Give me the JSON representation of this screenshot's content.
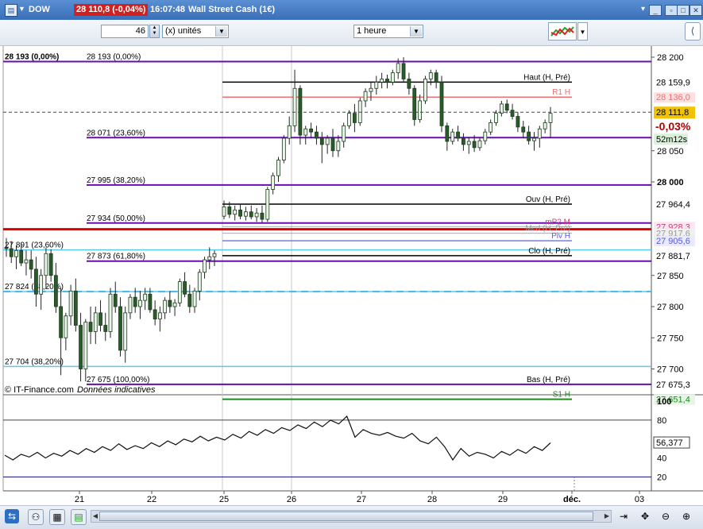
{
  "header": {
    "symbol": "DOW",
    "price_badge": "28 110,8 (-0,04%)",
    "time": "16:07:48",
    "instrument": "Wall Street Cash (1€)"
  },
  "toolbar": {
    "quantity": "46",
    "unit": "(x) unités",
    "period": "1 heure"
  },
  "colors": {
    "fibo": "#6a0dad",
    "haut": "#000000",
    "r1": "#f07070",
    "s1": "#1f8a1f",
    "red_line": "#e00000",
    "cyan": "#5bc8ef",
    "dashed": "#3fb8f0",
    "current": "#f2c200",
    "variation": "#b00000"
  },
  "chart_data": [
    {
      "type": "candlestick",
      "title": "",
      "xlabel": "",
      "ylabel": "",
      "ylim": [
        27640,
        28210
      ],
      "y_ticks": [
        "28 200",
        "28 050",
        "28 000",
        "27 850",
        "27 800",
        "27 750",
        "27 700"
      ],
      "x_ticks": [
        "21",
        "22",
        "25",
        "26",
        "27",
        "28",
        "29",
        "déc.",
        "03"
      ],
      "top_left_label": "28 193 (0,00%)",
      "current_price": "28 111,8",
      "variation": "-0,03%",
      "countdown": "52m12s",
      "watermark": "© IT-Finance.com",
      "watermark_note": "Données indicatives",
      "session_breaks": [
        "25",
        "26"
      ],
      "levels": [
        {
          "name": "fibo-0",
          "value": 28193,
          "label": "28 193 (0,00%)",
          "axis_label": "",
          "style": "fibo-top"
        },
        {
          "name": "haut",
          "value": 28160,
          "label": "Haut (H, Pré)",
          "axis_label": "28 159,9",
          "style": "haut"
        },
        {
          "name": "r1",
          "value": 28136,
          "label": "R1 H",
          "axis_label": "28 136,0",
          "style": "r1"
        },
        {
          "name": "fibo-23",
          "value": 28071,
          "label": "28 071 (23,60%)",
          "axis_label": "",
          "style": "fibo"
        },
        {
          "name": "fibo-38",
          "value": 27995,
          "label": "27 995 (38,20%)",
          "axis_label": "",
          "style": "fibo"
        },
        {
          "name": "ouv",
          "value": 27964.4,
          "label": "Ouv (H, Pré)",
          "axis_label": "27 964,4",
          "style": "haut"
        },
        {
          "name": "fibo-50",
          "value": 27934,
          "label": "27 934 (50,00%)",
          "axis_label": "",
          "style": "fibo"
        },
        {
          "name": "mp2",
          "value": 27928.3,
          "label": "mP2 M",
          "axis_label": "27 928,3",
          "style": "mp2"
        },
        {
          "name": "mcd",
          "value": 27917.6,
          "label": "Mcd (H, Pré)",
          "axis_label": "27 917,6",
          "style": "mcd"
        },
        {
          "name": "piv",
          "value": 27905.6,
          "label": "Piv H",
          "axis_label": "27 905,6",
          "style": "piv"
        },
        {
          "name": "clo",
          "value": 27881.7,
          "label": "Clo (H, Pré)",
          "axis_label": "27 881,7",
          "style": "haut"
        },
        {
          "name": "fibo-61",
          "value": 27873,
          "label": "27 873 (61,80%)",
          "axis_label": "",
          "style": "fibo"
        },
        {
          "name": "fibo-100",
          "value": 27675.3,
          "label": "27 675 (100,00%)",
          "axis_label": "27 675,3",
          "style": "fibo"
        },
        {
          "name": "bas",
          "value": 27675.3,
          "label": "Bas (H, Pré)",
          "axis_label": "",
          "style": "haut-short"
        },
        {
          "name": "s1",
          "value": 27651.4,
          "label": "S1 H",
          "axis_label": "27 651,4",
          "style": "s1"
        }
      ],
      "left_fibo": [
        {
          "value": 27891,
          "label": "27 891 (23,60%)"
        },
        {
          "value": 27824,
          "label": "27 824 (38,20%)"
        },
        {
          "value": 27704,
          "label": "27 704 (38,20%)"
        }
      ],
      "red_line": 27924,
      "dashed_line": 27824,
      "candles": [
        [
          27895,
          27910,
          27880,
          27893
        ],
        [
          27893,
          27905,
          27870,
          27880
        ],
        [
          27880,
          27898,
          27860,
          27890
        ],
        [
          27890,
          27902,
          27865,
          27870
        ],
        [
          27870,
          27890,
          27850,
          27875
        ],
        [
          27875,
          27890,
          27845,
          27860
        ],
        [
          27860,
          27880,
          27800,
          27820
        ],
        [
          27820,
          27860,
          27795,
          27850
        ],
        [
          27850,
          27895,
          27830,
          27885
        ],
        [
          27885,
          27892,
          27840,
          27850
        ],
        [
          27850,
          27870,
          27790,
          27800
        ],
        [
          27800,
          27830,
          27690,
          27750
        ],
        [
          27750,
          27790,
          27730,
          27785
        ],
        [
          27785,
          27835,
          27770,
          27825
        ],
        [
          27825,
          27845,
          27760,
          27770
        ],
        [
          27770,
          27790,
          27680,
          27700
        ],
        [
          27700,
          27780,
          27680,
          27775
        ],
        [
          27775,
          27800,
          27740,
          27760
        ],
        [
          27760,
          27800,
          27740,
          27790
        ],
        [
          27790,
          27810,
          27760,
          27770
        ],
        [
          27770,
          27790,
          27745,
          27760
        ],
        [
          27760,
          27830,
          27750,
          27820
        ],
        [
          27820,
          27840,
          27790,
          27800
        ],
        [
          27800,
          27815,
          27720,
          27730
        ],
        [
          27730,
          27800,
          27710,
          27790
        ],
        [
          27790,
          27820,
          27780,
          27815
        ],
        [
          27815,
          27830,
          27790,
          27800
        ],
        [
          27800,
          27825,
          27780,
          27810
        ],
        [
          27810,
          27830,
          27795,
          27820
        ],
        [
          27820,
          27830,
          27790,
          27795
        ],
        [
          27795,
          27810,
          27770,
          27780
        ],
        [
          27780,
          27800,
          27760,
          27790
        ],
        [
          27790,
          27815,
          27780,
          27810
        ],
        [
          27810,
          27825,
          27790,
          27800
        ],
        [
          27800,
          27812,
          27785,
          27806
        ],
        [
          27806,
          27845,
          27800,
          27840
        ],
        [
          27840,
          27855,
          27815,
          27820
        ],
        [
          27820,
          27835,
          27790,
          27800
        ],
        [
          27800,
          27830,
          27790,
          27825
        ],
        [
          27825,
          27860,
          27810,
          27855
        ],
        [
          27855,
          27880,
          27845,
          27875
        ],
        [
          27875,
          27895,
          27860,
          27880
        ],
        [
          27880,
          27890,
          27865,
          27885
        ],
        [
          27945,
          27970,
          27940,
          27960
        ],
        [
          27960,
          27968,
          27942,
          27948
        ],
        [
          27948,
          27962,
          27938,
          27955
        ],
        [
          27955,
          27965,
          27940,
          27945
        ],
        [
          27945,
          27960,
          27938,
          27952
        ],
        [
          27952,
          27962,
          27940,
          27944
        ],
        [
          27944,
          27958,
          27936,
          27950
        ],
        [
          27950,
          27962,
          27935,
          27940
        ],
        [
          27940,
          27992,
          27936,
          27988
        ],
        [
          27988,
          28015,
          27980,
          28010
        ],
        [
          28010,
          28040,
          28000,
          28035
        ],
        [
          28035,
          28075,
          28030,
          28070
        ],
        [
          28070,
          28105,
          28060,
          28090
        ],
        [
          28090,
          28180,
          28080,
          28150
        ],
        [
          28150,
          28155,
          28060,
          28075
        ],
        [
          28075,
          28090,
          28060,
          28085
        ],
        [
          28085,
          28095,
          28070,
          28080
        ],
        [
          28080,
          28090,
          28060,
          28070
        ],
        [
          28070,
          28080,
          28030,
          28060
        ],
        [
          28060,
          28075,
          28045,
          28070
        ],
        [
          28070,
          28085,
          28040,
          28050
        ],
        [
          28050,
          28075,
          28040,
          28065
        ],
        [
          28065,
          28095,
          28055,
          28090
        ],
        [
          28090,
          28115,
          28085,
          28110
        ],
        [
          28110,
          28125,
          28080,
          28095
        ],
        [
          28095,
          28135,
          28090,
          28130
        ],
        [
          28130,
          28150,
          28120,
          28145
        ],
        [
          28145,
          28160,
          28130,
          28150
        ],
        [
          28150,
          28170,
          28140,
          28160
        ],
        [
          28160,
          28175,
          28150,
          28165
        ],
        [
          28165,
          28172,
          28150,
          28160
        ],
        [
          28160,
          28180,
          28155,
          28175
        ],
        [
          28175,
          28198,
          28165,
          28190
        ],
        [
          28190,
          28200,
          28160,
          28165
        ],
        [
          28165,
          28175,
          28140,
          28150
        ],
        [
          28150,
          28155,
          28090,
          28100
        ],
        [
          28100,
          28140,
          28095,
          28130
        ],
        [
          28130,
          28170,
          28125,
          28165
        ],
        [
          28165,
          28180,
          28155,
          28175
        ],
        [
          28175,
          28180,
          28150,
          28160
        ],
        [
          28160,
          28170,
          28080,
          28090
        ],
        [
          28090,
          28095,
          28050,
          28065
        ],
        [
          28065,
          28085,
          28060,
          28080
        ],
        [
          28080,
          28090,
          28065,
          28070
        ],
        [
          28070,
          28078,
          28050,
          28060
        ],
        [
          28060,
          28072,
          28045,
          28065
        ],
        [
          28065,
          28075,
          28048,
          28055
        ],
        [
          28055,
          28070,
          28050,
          28066
        ],
        [
          28066,
          28085,
          28060,
          28080
        ],
        [
          28080,
          28100,
          28075,
          28095
        ],
        [
          28095,
          28115,
          28090,
          28110
        ],
        [
          28110,
          28130,
          28105,
          28125
        ],
        [
          28125,
          28132,
          28110,
          28115
        ],
        [
          28115,
          28125,
          28100,
          28105
        ],
        [
          28105,
          28112,
          28080,
          28088
        ],
        [
          28088,
          28098,
          28070,
          28080
        ],
        [
          28080,
          28090,
          28060,
          28066
        ],
        [
          28066,
          28080,
          28050,
          28070
        ],
        [
          28070,
          28090,
          28055,
          28085
        ],
        [
          28085,
          28100,
          28078,
          28095
        ],
        [
          28095,
          28120,
          28070,
          28110
        ]
      ]
    },
    {
      "type": "line",
      "title": "",
      "xlabel": "",
      "ylabel": "",
      "ylim": [
        0,
        100
      ],
      "y_ticks": [
        "100",
        "80",
        "60",
        "40",
        "20"
      ],
      "current_value": "56,377",
      "levels": [
        80,
        20
      ],
      "values": [
        43,
        38,
        44,
        41,
        46,
        40,
        45,
        42,
        48,
        44,
        50,
        46,
        52,
        48,
        55,
        49,
        53,
        50,
        56,
        52,
        58,
        54,
        60,
        57,
        63,
        58,
        62,
        59,
        65,
        61,
        68,
        64,
        70,
        66,
        72,
        69,
        75,
        71,
        78,
        73,
        80,
        76,
        84,
        62,
        70,
        66,
        64,
        67,
        63,
        61,
        66,
        58,
        55,
        62,
        52,
        38,
        50,
        42,
        46,
        44,
        40,
        47,
        43,
        49,
        45,
        52,
        48,
        56
      ]
    }
  ]
}
